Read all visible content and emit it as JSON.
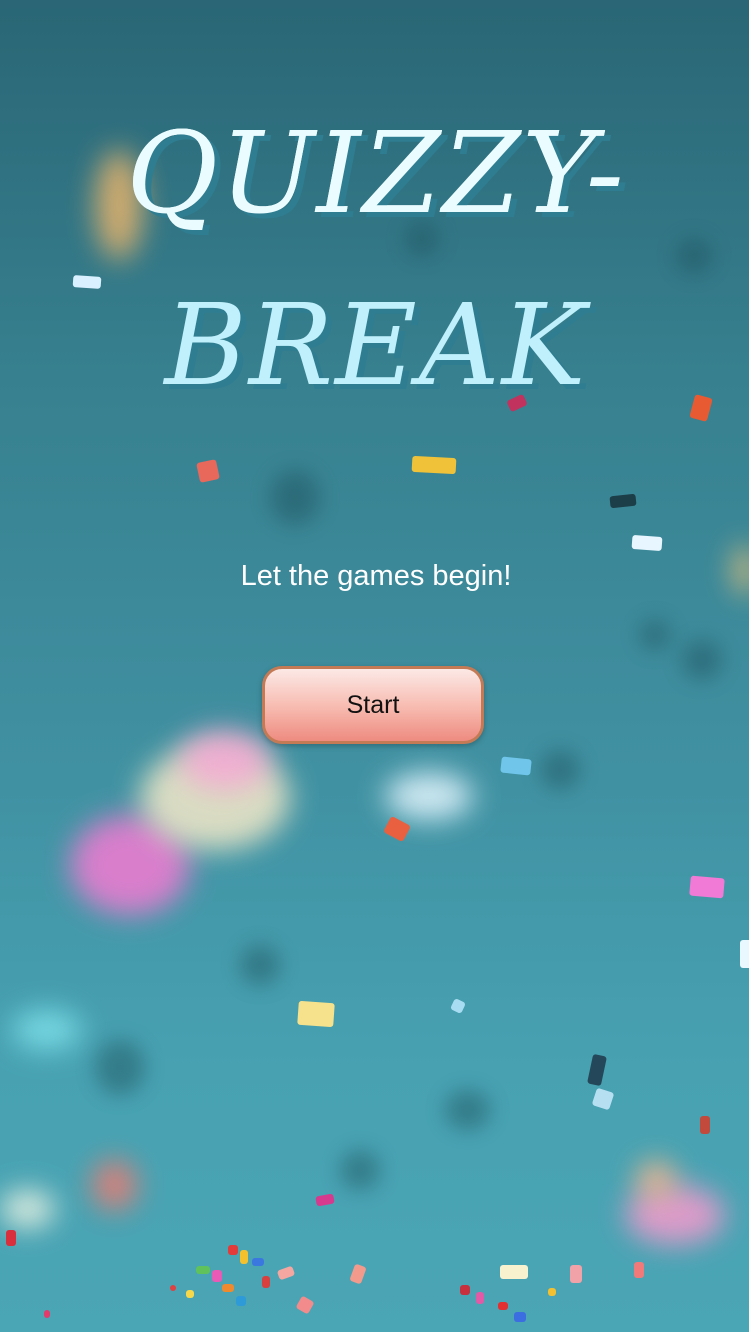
{
  "app": {
    "title_line_1": "QUIZZY-",
    "title_line_2": "BREAK",
    "tagline": "Let the games begin!",
    "start_button_label": "Start"
  },
  "colors": {
    "background_top": "#2a6675",
    "background_bottom": "#4aa5b5",
    "title_text": "#e9fbff",
    "title_shadow": "#2f7d91",
    "button_gradient_top": "#fce9e6",
    "button_gradient_bottom": "#ee8b80",
    "button_border": "#c47a55"
  },
  "decorations": {
    "background_image": "confetti-background"
  }
}
